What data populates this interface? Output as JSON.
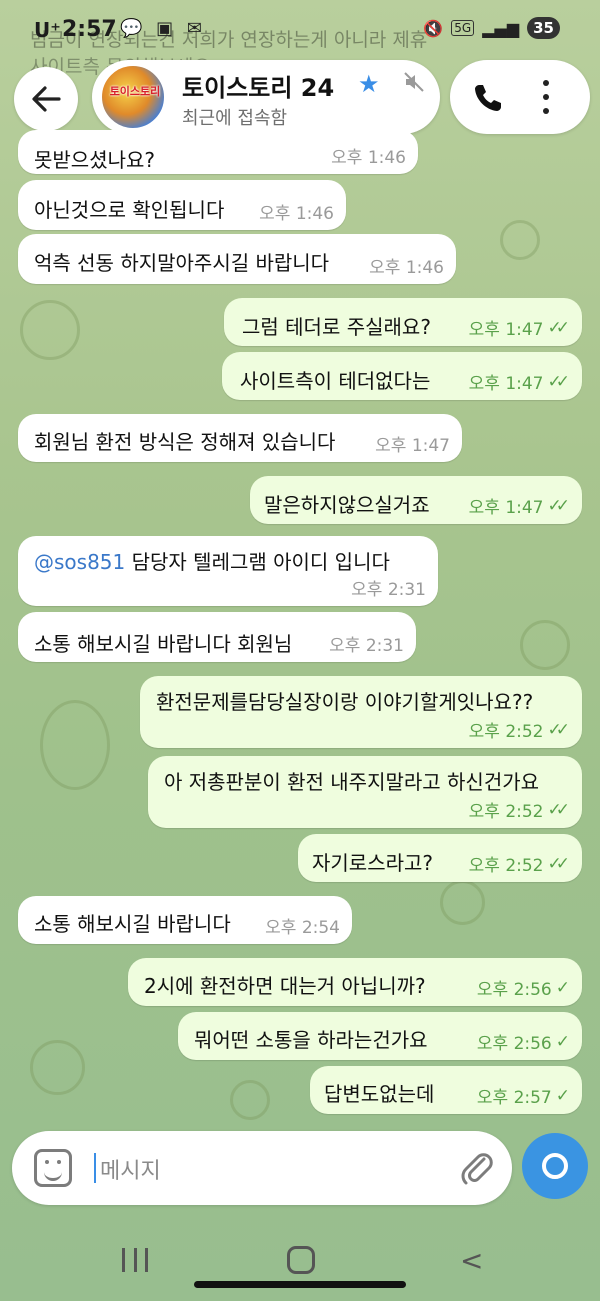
{
  "status_bar": {
    "carrier": "U⁺",
    "time": "2:57",
    "network": "5G",
    "battery": "35",
    "pinned_preview": "범금이 연장되는건 저희가 연장하는게 아니라 제휴",
    "pinned_preview_2": "사이트측 문의해보세요"
  },
  "header": {
    "avatar_text": "토이스토리",
    "title": "토이스토리 24",
    "subtitle": "최근에 접속함"
  },
  "messages": [
    {
      "text": "못받으셨나요?",
      "time": "오후 1:46",
      "dir": "in"
    },
    {
      "text": "아닌것으로 확인됩니다",
      "time": "오후 1:46",
      "dir": "in"
    },
    {
      "text": "억측 선동 하지말아주시길 바랍니다",
      "time": "오후 1:46",
      "dir": "in"
    },
    {
      "text": "그럼 테더로 주실래요?",
      "time": "오후 1:47",
      "dir": "out",
      "status": "✓✓"
    },
    {
      "text": "사이트측이 테더없다는",
      "time": "오후 1:47",
      "dir": "out",
      "status": "✓✓"
    },
    {
      "text": "회원님 환전 방식은 정해져 있습니다",
      "time": "오후 1:47",
      "dir": "in"
    },
    {
      "text": "말은하지않으실거죠",
      "time": "오후 1:47",
      "dir": "out",
      "status": "✓✓"
    },
    {
      "mention": "@sos851",
      "text": " 담당자 텔레그램 아이디 입니다",
      "time": "오후 2:31",
      "dir": "in"
    },
    {
      "text": "소통 해보시길 바랍니다 회원님",
      "time": "오후 2:31",
      "dir": "in"
    },
    {
      "text": "환전문제를담당실장이랑 이야기할게잇나요??",
      "time": "오후 2:52",
      "dir": "out",
      "status": "✓✓"
    },
    {
      "text": "아 저총판분이 환전 내주지말라고 하신건가요",
      "time": "오후 2:52",
      "dir": "out",
      "status": "✓✓"
    },
    {
      "text": "자기로스라고?",
      "time": "오후 2:52",
      "dir": "out",
      "status": "✓✓"
    },
    {
      "text": "소통 해보시길 바랍니다",
      "time": "오후 2:54",
      "dir": "in"
    },
    {
      "text": "2시에 환전하면 대는거 아닙니까?",
      "time": "오후 2:56",
      "dir": "out",
      "status": "✓"
    },
    {
      "text": "뭐어떤 소통을 하라는건가요",
      "time": "오후 2:56",
      "dir": "out",
      "status": "✓"
    },
    {
      "text": "답변도없는데",
      "time": "오후 2:57",
      "dir": "out",
      "status": "✓"
    }
  ],
  "input": {
    "placeholder": "메시지"
  },
  "colors": {
    "accent": "#3a94e2",
    "outgoing_bubble": "#effdde",
    "incoming_bubble": "#ffffff",
    "read_check": "#5aa14b"
  }
}
